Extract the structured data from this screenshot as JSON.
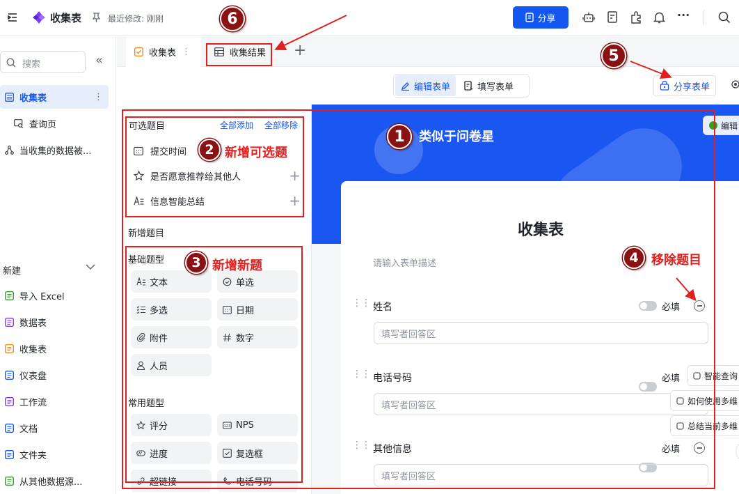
{
  "topbar": {
    "title": "收集表",
    "meta": "最近修改: 刚刚",
    "share_label": "分享",
    "more_label": "···"
  },
  "sidebar": {
    "search_placeholder": "搜索",
    "collapse_label": "«",
    "tree": [
      {
        "label": "收集表",
        "icon": "form-icon"
      },
      {
        "label": "查询页",
        "icon": "query-page-icon"
      },
      {
        "label": "当收集的数据被...",
        "icon": "workflow-icon"
      }
    ],
    "new_label": "新建",
    "new_items": [
      {
        "label": "导入 Excel",
        "color": "#2ea121"
      },
      {
        "label": "数据表",
        "color": "#7f3bf5"
      },
      {
        "label": "收集表",
        "color": "#f28c16"
      },
      {
        "label": "仪表盘",
        "color": "#1456f0"
      },
      {
        "label": "工作流",
        "color": "#7f3bf5"
      },
      {
        "label": "文档",
        "color": "#1456f0"
      },
      {
        "label": "文件夹",
        "color": "#1456f0"
      },
      {
        "label": "从其他数据源...",
        "color": "#2ea121"
      }
    ]
  },
  "tabs": [
    {
      "label": "收集表",
      "more": "⋮"
    },
    {
      "label": "收集结果"
    }
  ],
  "add_tab": "+",
  "modes": {
    "edit": "编辑表单",
    "fill": "填写表单",
    "share_form": "分享表单"
  },
  "left_panel": {
    "optional_title": "可选题目",
    "add_all": "全部添加",
    "remove_all": "全部移除",
    "optional_items": [
      "提交时间",
      "是否愿意推荐给其他人",
      "信息智能总结"
    ],
    "new_title": "新增题目",
    "basic_title": "基础题型",
    "basic_types": [
      "文本",
      "单选",
      "多选",
      "日期",
      "附件",
      "数字",
      "人员"
    ],
    "common_title": "常用题型",
    "common_types": [
      "评分",
      "NPS",
      "进度",
      "复选框",
      "超链接",
      "电话号码"
    ]
  },
  "form": {
    "edit_chip": "编辑",
    "title": "收集表",
    "description_placeholder": "请输入表单描述",
    "required_label": "必填",
    "answer_placeholder": "填写者回答区",
    "questions": [
      {
        "label": "姓名"
      },
      {
        "label": "电话号码"
      },
      {
        "label": "其他信息"
      }
    ],
    "ai_chips": [
      "智能查询",
      "如何使用多维",
      "总结当前多维"
    ]
  },
  "annotations": {
    "a1": {
      "num": "1",
      "text": "类似于问卷星"
    },
    "a2": {
      "num": "2",
      "text": "新增可选题"
    },
    "a3": {
      "num": "3",
      "text": "新增新题"
    },
    "a4": {
      "num": "4",
      "text": "移除题目"
    },
    "a5": {
      "num": "5"
    },
    "a6": {
      "num": "6"
    }
  }
}
